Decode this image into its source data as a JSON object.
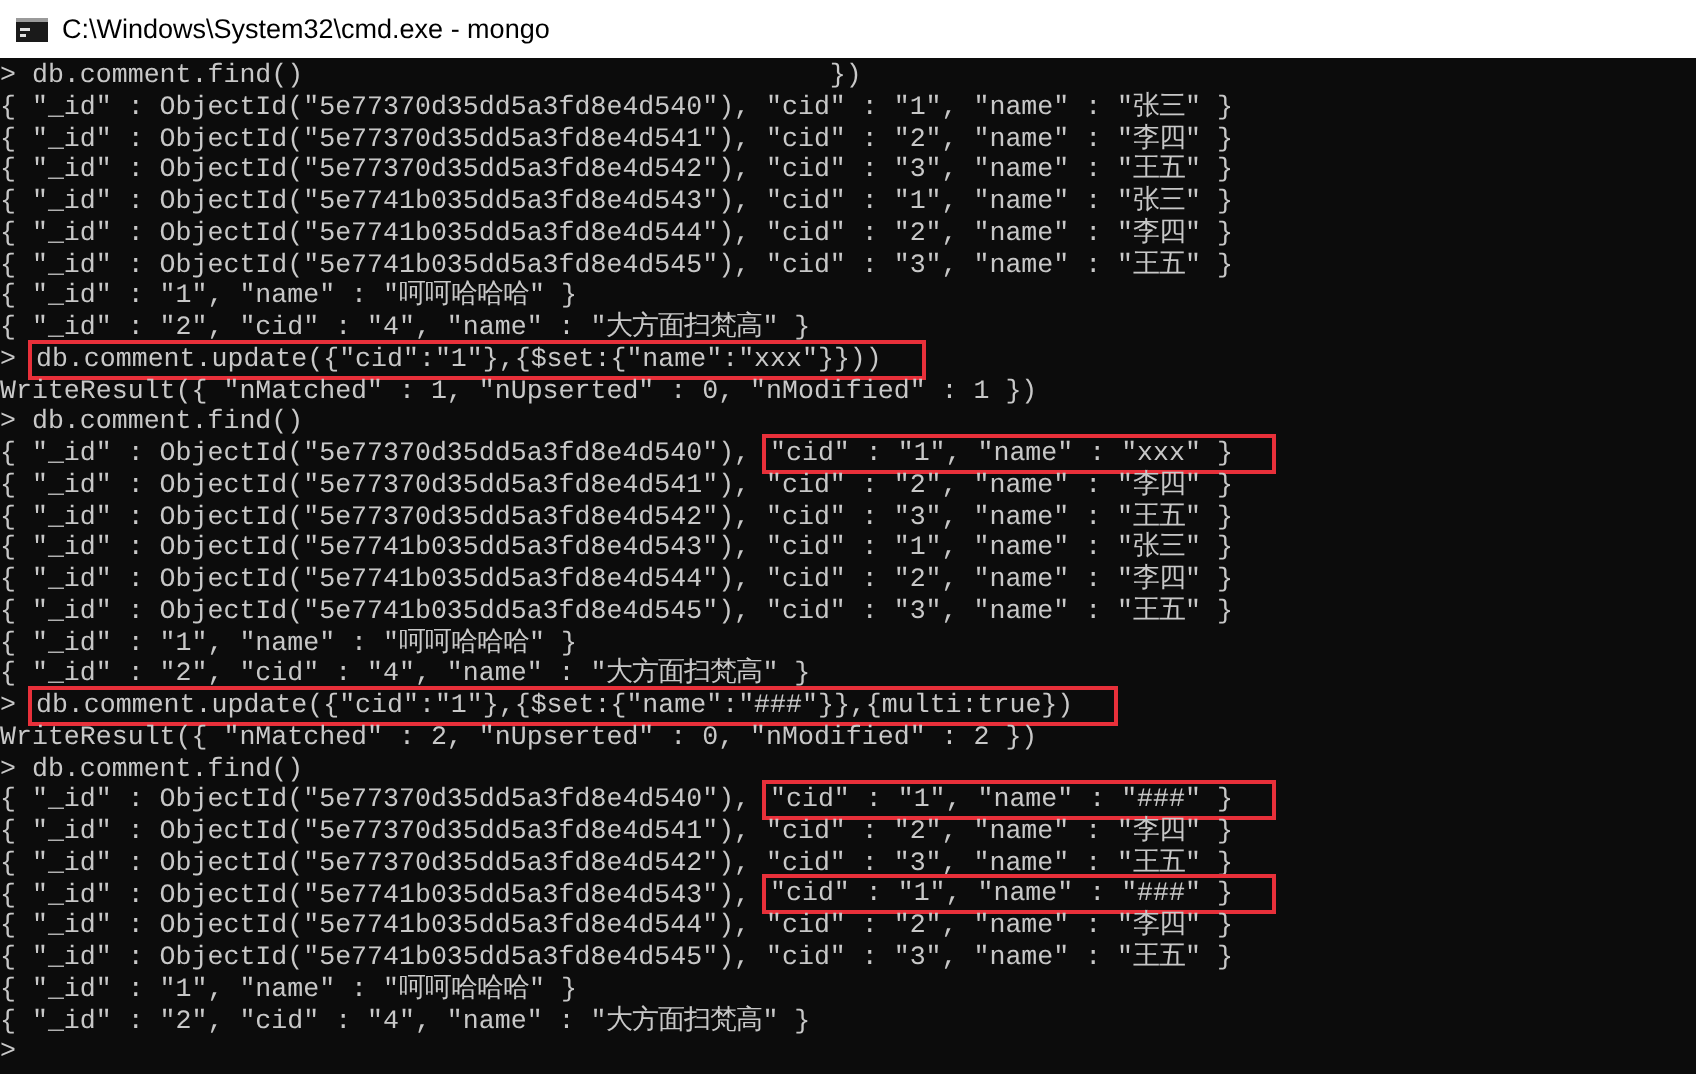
{
  "window": {
    "title": "C:\\Windows\\System32\\cmd.exe - mongo"
  },
  "lines": [
    {
      "segments": [
        {
          "text": "> db.comment.find()",
          "boxed": false
        },
        {
          "kind": "stray",
          "text": "})",
          "boxed": false
        }
      ]
    },
    {
      "segments": [
        {
          "text": "{ \"_id\" : ObjectId(\"5e77370d35dd5a3fd8e4d540\"), \"cid\" : \"1\", \"name\" : \"张三\" }",
          "boxed": false
        }
      ]
    },
    {
      "segments": [
        {
          "text": "{ \"_id\" : ObjectId(\"5e77370d35dd5a3fd8e4d541\"), \"cid\" : \"2\", \"name\" : \"李四\" }",
          "boxed": false
        }
      ]
    },
    {
      "segments": [
        {
          "text": "{ \"_id\" : ObjectId(\"5e77370d35dd5a3fd8e4d542\"), \"cid\" : \"3\", \"name\" : \"王五\" }",
          "boxed": false
        }
      ]
    },
    {
      "segments": [
        {
          "text": "{ \"_id\" : ObjectId(\"5e7741b035dd5a3fd8e4d543\"), \"cid\" : \"1\", \"name\" : \"张三\" }",
          "boxed": false
        }
      ]
    },
    {
      "segments": [
        {
          "text": "{ \"_id\" : ObjectId(\"5e7741b035dd5a3fd8e4d544\"), \"cid\" : \"2\", \"name\" : \"李四\" }",
          "boxed": false
        }
      ]
    },
    {
      "segments": [
        {
          "text": "{ \"_id\" : ObjectId(\"5e7741b035dd5a3fd8e4d545\"), \"cid\" : \"3\", \"name\" : \"王五\" }",
          "boxed": false
        }
      ]
    },
    {
      "segments": [
        {
          "text": "{ \"_id\" : \"1\", \"name\" : \"呵呵哈哈哈\" }",
          "boxed": false
        }
      ]
    },
    {
      "segments": [
        {
          "text": "{ \"_id\" : \"2\", \"cid\" : \"4\", \"name\" : \"大方面扫梵高\" }",
          "boxed": false
        }
      ]
    },
    {
      "segments": [
        {
          "text": "> ",
          "boxed": false
        },
        {
          "text": "db.comment.update({\"cid\":\"1\"},{$set:{\"name\":\"xxx\"}}))",
          "boxed": true
        }
      ]
    },
    {
      "segments": [
        {
          "text": "WriteResult({ \"nMatched\" : 1, \"nUpserted\" : 0, \"nModified\" : 1 })",
          "boxed": false
        }
      ]
    },
    {
      "segments": [
        {
          "text": "> db.comment.find()",
          "boxed": false
        }
      ]
    },
    {
      "segments": [
        {
          "text": "{ \"_id\" : ObjectId(\"5e77370d35dd5a3fd8e4d540\"), ",
          "boxed": false
        },
        {
          "text": "\"cid\" : \"1\", \"name\" : \"xxx\" }",
          "boxed": true
        }
      ]
    },
    {
      "segments": [
        {
          "text": "{ \"_id\" : ObjectId(\"5e77370d35dd5a3fd8e4d541\"), \"cid\" : \"2\", \"name\" : \"李四\" }",
          "boxed": false
        }
      ]
    },
    {
      "segments": [
        {
          "text": "{ \"_id\" : ObjectId(\"5e77370d35dd5a3fd8e4d542\"), \"cid\" : \"3\", \"name\" : \"王五\" }",
          "boxed": false
        }
      ]
    },
    {
      "segments": [
        {
          "text": "{ \"_id\" : ObjectId(\"5e7741b035dd5a3fd8e4d543\"), \"cid\" : \"1\", \"name\" : \"张三\" }",
          "boxed": false
        }
      ]
    },
    {
      "segments": [
        {
          "text": "{ \"_id\" : ObjectId(\"5e7741b035dd5a3fd8e4d544\"), \"cid\" : \"2\", \"name\" : \"李四\" }",
          "boxed": false
        }
      ]
    },
    {
      "segments": [
        {
          "text": "{ \"_id\" : ObjectId(\"5e7741b035dd5a3fd8e4d545\"), \"cid\" : \"3\", \"name\" : \"王五\" }",
          "boxed": false
        }
      ]
    },
    {
      "segments": [
        {
          "text": "{ \"_id\" : \"1\", \"name\" : \"呵呵哈哈哈\" }",
          "boxed": false
        }
      ]
    },
    {
      "segments": [
        {
          "text": "{ \"_id\" : \"2\", \"cid\" : \"4\", \"name\" : \"大方面扫梵高\" }",
          "boxed": false
        }
      ]
    },
    {
      "segments": [
        {
          "text": "> ",
          "boxed": false
        },
        {
          "text": "db.comment.update({\"cid\":\"1\"},{$set:{\"name\":\"###\"}},{multi:true})",
          "boxed": true
        }
      ]
    },
    {
      "segments": [
        {
          "text": "WriteResult({ \"nMatched\" : 2, \"nUpserted\" : 0, \"nModified\" : 2 })",
          "boxed": false
        }
      ]
    },
    {
      "segments": [
        {
          "text": "> db.comment.find()",
          "boxed": false
        }
      ]
    },
    {
      "segments": [
        {
          "text": "{ \"_id\" : ObjectId(\"5e77370d35dd5a3fd8e4d540\"), ",
          "boxed": false
        },
        {
          "text": "\"cid\" : \"1\", \"name\" : \"###\" }",
          "boxed": true
        }
      ]
    },
    {
      "segments": [
        {
          "text": "{ \"_id\" : ObjectId(\"5e77370d35dd5a3fd8e4d541\"), \"cid\" : \"2\", \"name\" : \"李四\" }",
          "boxed": false
        }
      ]
    },
    {
      "segments": [
        {
          "text": "{ \"_id\" : ObjectId(\"5e77370d35dd5a3fd8e4d542\"), \"cid\" : \"3\", \"name\" : \"王五\" }",
          "boxed": false
        }
      ]
    },
    {
      "segments": [
        {
          "text": "{ \"_id\" : ObjectId(\"5e7741b035dd5a3fd8e4d543\"), ",
          "boxed": false
        },
        {
          "text": "\"cid\" : \"1\", \"name\" : \"###\" }",
          "boxed": true
        }
      ]
    },
    {
      "segments": [
        {
          "text": "{ \"_id\" : ObjectId(\"5e7741b035dd5a3fd8e4d544\"), \"cid\" : \"2\", \"name\" : \"李四\" }",
          "boxed": false
        }
      ]
    },
    {
      "segments": [
        {
          "text": "{ \"_id\" : ObjectId(\"5e7741b035dd5a3fd8e4d545\"), \"cid\" : \"3\", \"name\" : \"王五\" }",
          "boxed": false
        }
      ]
    },
    {
      "segments": [
        {
          "text": "{ \"_id\" : \"1\", \"name\" : \"呵呵哈哈哈\" }",
          "boxed": false
        }
      ]
    },
    {
      "segments": [
        {
          "text": "{ \"_id\" : \"2\", \"cid\" : \"4\", \"name\" : \"大方面扫梵高\" }",
          "boxed": false
        }
      ]
    },
    {
      "segments": [
        {
          "text": ">",
          "boxed": false
        }
      ]
    }
  ]
}
